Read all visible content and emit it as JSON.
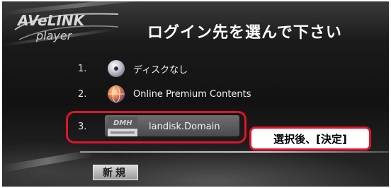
{
  "logo": {
    "line1": "AVeLINK",
    "line2": "player"
  },
  "title": "ログイン先を選んで下さい",
  "items": [
    {
      "number": "1.",
      "icon": "disc-icon",
      "label": "ディスクなし"
    },
    {
      "number": "2.",
      "icon": "globe-icon",
      "label": "Online Premium Contents"
    },
    {
      "number": "3.",
      "icon": "nas-device-icon",
      "icon_text": "DMH",
      "label": "landisk.Domain"
    }
  ],
  "callout": "選択後、[決定]",
  "new_button": "新規",
  "colors": {
    "highlight_red": "#e0142a",
    "background": "#121212",
    "text": "#ffffff"
  }
}
